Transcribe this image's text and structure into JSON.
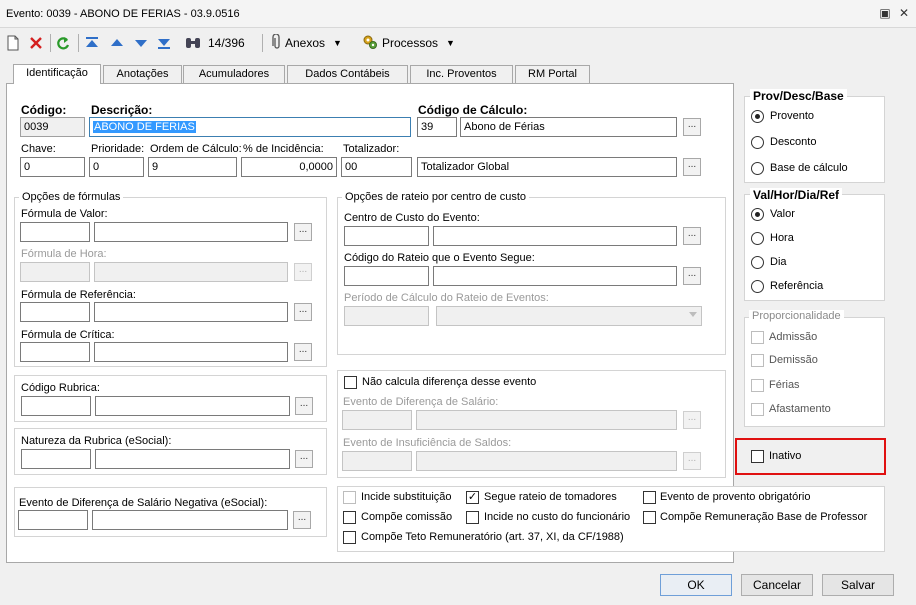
{
  "window": {
    "title": "Evento: 0039 - ABONO DE FERIAS - 03.9.0516",
    "restore_icon": "restore-icon",
    "close_icon": "close-icon"
  },
  "toolbar": {
    "record_counter": "14/396",
    "attachments_label": "Anexos",
    "processes_label": "Processos"
  },
  "tabs": [
    {
      "label": "Identificação",
      "active": true
    },
    {
      "label": "Anotações"
    },
    {
      "label": "Acumuladores"
    },
    {
      "label": "Dados Contábeis"
    },
    {
      "label": "Inc. Proventos"
    },
    {
      "label": "RM Portal"
    }
  ],
  "identification": {
    "codigo_label": "Código:",
    "codigo_value": "0039",
    "descricao_label": "Descrição:",
    "descricao_value": "ABONO DE FERIAS",
    "codigo_calculo_label": "Código de Cálculo:",
    "codigo_calculo_value": "39",
    "codigo_calculo_desc": "Abono de Férias",
    "chave_label": "Chave:",
    "chave_value": "0",
    "prioridade_label": "Prioridade:",
    "prioridade_value": "0",
    "ordem_label": "Ordem de Cálculo:",
    "ordem_value": "9",
    "incidencia_label": "% de Incidência:",
    "incidencia_value": "0,0000",
    "totalizador_label": "Totalizador:",
    "totalizador_value": "00",
    "totalizador_desc": "Totalizador Global"
  },
  "formulas": {
    "title": "Opções de fórmulas",
    "valor_label": "Fórmula de Valor:",
    "hora_label": "Fórmula de Hora:",
    "referencia_label": "Fórmula de Referência:",
    "critica_label": "Fórmula de Crítica:"
  },
  "rateio": {
    "title": "Opções de rateio por centro de custo",
    "centro_label": "Centro de Custo do Evento:",
    "codigo_rateio_label": "Código do Rateio que o Evento Segue:",
    "periodo_label": "Período de Cálculo do Rateio de Eventos:"
  },
  "rubrica": {
    "codigo_label": "Código Rubrica:",
    "natureza_label": "Natureza da Rubrica (eSocial):",
    "dif_negativa_label": "Evento de Diferença de Salário Negativa (eSocial):"
  },
  "diferenca": {
    "nao_calcula_label": "Não calcula diferença desse evento",
    "dif_salario_label": "Evento de Diferença de Salário:",
    "insuficiencia_label": "Evento de Insuficiência de Saldos:"
  },
  "flags": {
    "incide_substituicao": "Incide substituição",
    "segue_rateio": "Segue rateio de tomadores",
    "provento_obrigatorio": "Evento de provento obrigatório",
    "compoe_comissao": "Compõe comissão",
    "incide_custo": "Incide no custo do funcionário",
    "compoe_remuneracao": "Compõe Remuneração Base de Professor",
    "compoe_teto": "Compõe Teto Remuneratório (art. 37, XI, da CF/1988)"
  },
  "prov_desc_base": {
    "title": "Prov/Desc/Base",
    "options": [
      "Provento",
      "Desconto",
      "Base de cálculo"
    ],
    "selected": "Provento"
  },
  "val_hor_dia_ref": {
    "title": "Val/Hor/Dia/Ref",
    "options": [
      "Valor",
      "Hora",
      "Dia",
      "Referência"
    ],
    "selected": "Valor"
  },
  "proporcionalidade": {
    "title": "Proporcionalidade",
    "options": [
      "Admissão",
      "Demissão",
      "Férias",
      "Afastamento"
    ]
  },
  "inativo_label": "Inativo",
  "buttons": {
    "ok": "OK",
    "cancel": "Cancelar",
    "save": "Salvar",
    "ellipsis": "..."
  }
}
